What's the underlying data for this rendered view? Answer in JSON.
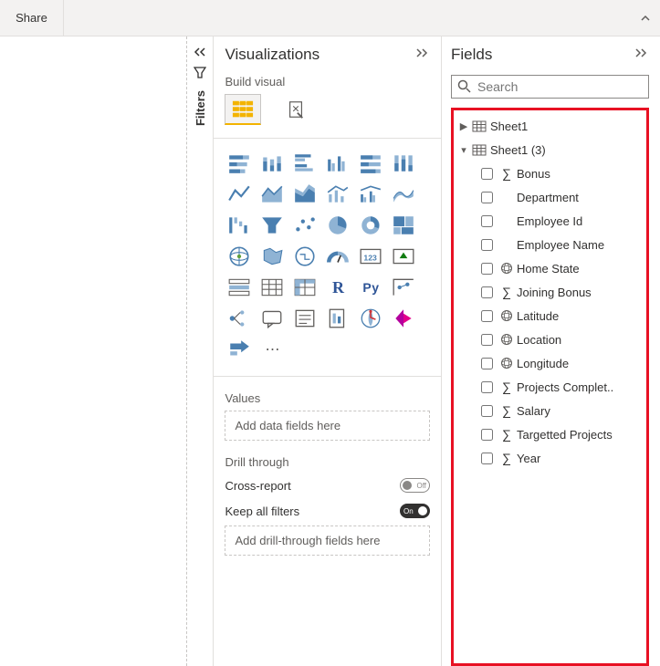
{
  "topbar": {
    "share_label": "Share"
  },
  "filters": {
    "label": "Filters"
  },
  "viz": {
    "title": "Visualizations",
    "build_label": "Build visual",
    "values_label": "Values",
    "values_placeholder": "Add data fields here",
    "drill_label": "Drill through",
    "cross_report_label": "Cross-report",
    "cross_report_state": "Off",
    "keep_filters_label": "Keep all filters",
    "keep_filters_state": "On",
    "drill_placeholder": "Add drill-through fields here"
  },
  "fields": {
    "title": "Fields",
    "search_placeholder": "Search",
    "tables": [
      {
        "name": "Sheet1",
        "expanded": false
      },
      {
        "name": "Sheet1 (3)",
        "expanded": true
      }
    ],
    "columns": [
      {
        "name": "Bonus",
        "type": "sigma"
      },
      {
        "name": "Department",
        "type": "none"
      },
      {
        "name": "Employee Id",
        "type": "none"
      },
      {
        "name": "Employee Name",
        "type": "none"
      },
      {
        "name": "Home State",
        "type": "globe"
      },
      {
        "name": "Joining Bonus",
        "type": "sigma"
      },
      {
        "name": "Latitude",
        "type": "globe"
      },
      {
        "name": "Location",
        "type": "globe"
      },
      {
        "name": "Longitude",
        "type": "globe"
      },
      {
        "name": "Projects Complet..",
        "type": "sigma"
      },
      {
        "name": "Salary",
        "type": "sigma"
      },
      {
        "name": "Targetted Projects",
        "type": "sigma"
      },
      {
        "name": "Year",
        "type": "sigma"
      }
    ]
  }
}
